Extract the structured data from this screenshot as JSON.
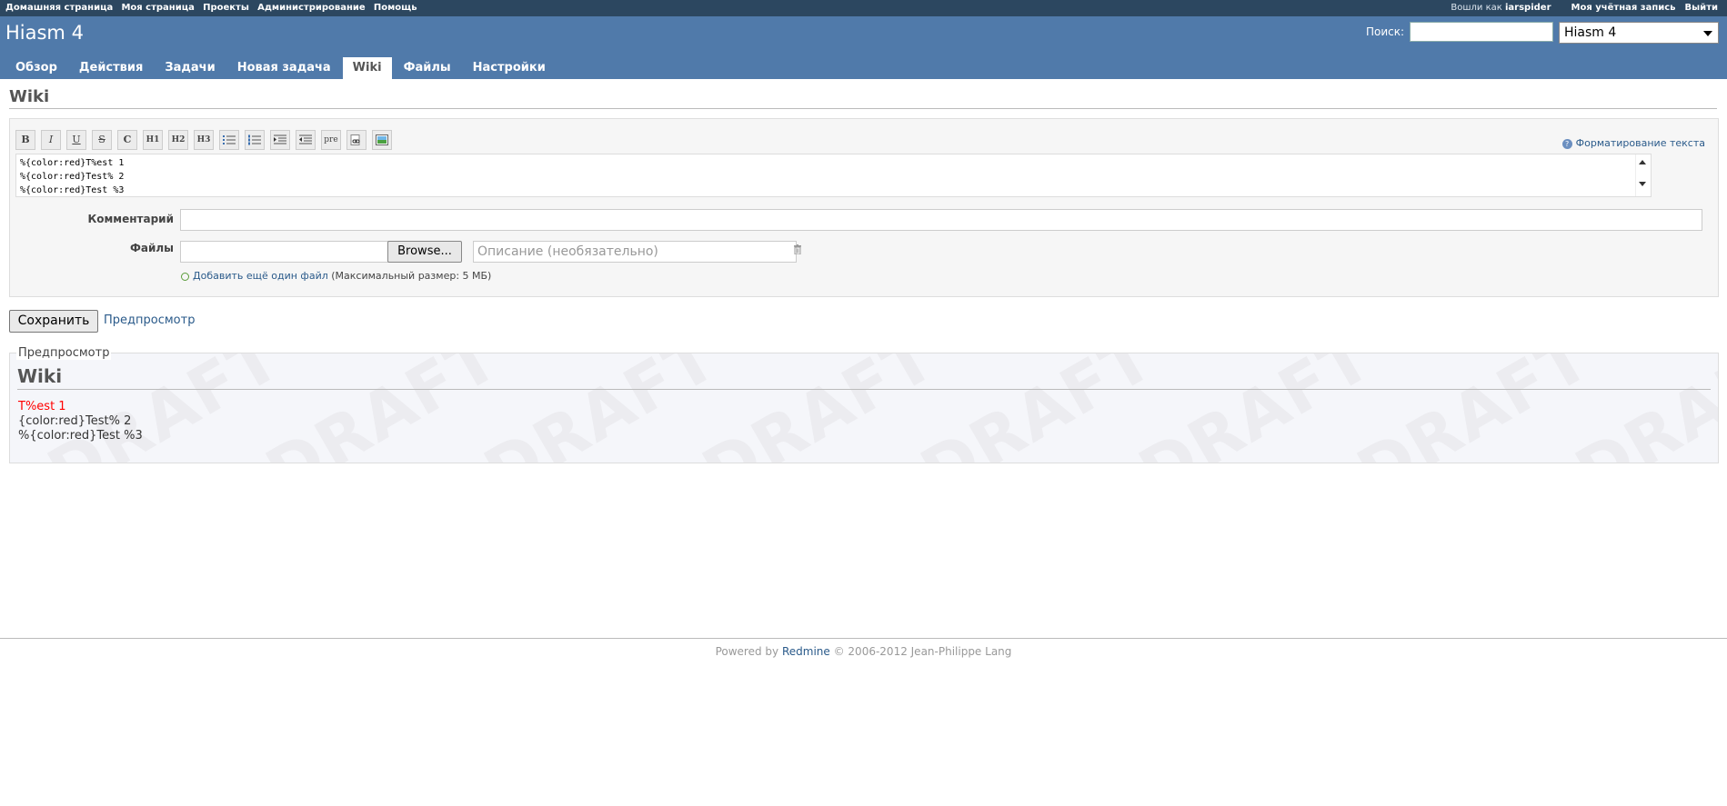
{
  "top_menu": {
    "items": [
      "Домашняя страница",
      "Моя страница",
      "Проекты",
      "Администрирование",
      "Помощь"
    ],
    "logged_as_label": "Вошли как",
    "username": "iarspider",
    "my_account": "Моя учётная запись",
    "logout": "Выйти"
  },
  "header": {
    "title": "Hiasm 4",
    "search_label": "Поиск:",
    "search_value": "",
    "project_select": "Hiasm 4",
    "tabs": [
      "Обзор",
      "Действия",
      "Задачи",
      "Новая задача",
      "Wiki",
      "Файлы",
      "Настройки"
    ],
    "selected_tab": "Wiki"
  },
  "page": {
    "title": "Wiki",
    "toolbar": {
      "buttons": [
        "B",
        "I",
        "U",
        "S",
        "C",
        "H1",
        "H2",
        "H3",
        "ul",
        "ol",
        "left",
        "right",
        "pre",
        "link",
        "image"
      ],
      "pre_label": "pre"
    },
    "format_help": "Форматирование текста",
    "editor_lines": [
      "%{color:red}T%est 1",
      "%{color:red}Test% 2",
      "%{color:red}Test %3"
    ],
    "comment_label": "Комментарий",
    "comment_value": "",
    "files_label": "Файлы",
    "browse_label": "Browse...",
    "description_placeholder": "Описание (необязательно)",
    "add_file_link": "Добавить ещё один файл",
    "max_size_hint": "(Максимальный размер: 5 МБ)",
    "save_label": "Сохранить",
    "preview_link": "Предпросмотр"
  },
  "preview": {
    "legend": "Предпросмотр",
    "heading": "Wiki",
    "watermark": "DRAFT",
    "lines": [
      "T%est 1",
      "{color:red}Test% 2",
      "%{color:red}Test %3"
    ],
    "first_line_color": "#ff0000"
  },
  "footer": {
    "powered_by": "Powered by",
    "product": "Redmine",
    "copyright": "© 2006-2012 Jean-Philippe Lang"
  }
}
